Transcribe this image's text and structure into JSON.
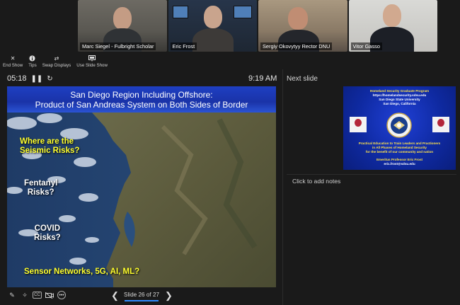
{
  "participants": [
    {
      "name": "Marc Siegel - Fulbright Scholar",
      "active": false
    },
    {
      "name": "Eric Frost",
      "active": true
    },
    {
      "name": "Sergiy Okovytyy Rector DNU",
      "active": false
    },
    {
      "name": "Vitor Gasso",
      "active": false
    }
  ],
  "toolbar": {
    "end_show": "End Show",
    "tips": "Tips",
    "swap_displays": "Swap Displays",
    "use_slide_show": "Use Slide Show"
  },
  "presenter": {
    "timer": "05:18",
    "clock": "9:19 AM",
    "slide_count": "Slide 26 of 27"
  },
  "slide": {
    "title_line1": "San Diego Region Including Offshore:",
    "title_line2": "Product of San Andreas System on Both Sides of Border",
    "callouts": {
      "seismic_1": "Where are the",
      "seismic_2": "Seismic Risks?",
      "fentanyl_1": "Fentanyl",
      "fentanyl_2": "Risks?",
      "covid_1": "COVID",
      "covid_2": "Risks?",
      "sensor": "Sensor Networks, 5G, AI, ML?"
    }
  },
  "next_panel": {
    "label": "Next slide",
    "notes_placeholder": "Click to add notes"
  },
  "next_slide": {
    "line1": "Homeland Security Graduate Program",
    "line2": "https://homelandsecurity.sdsu.edu",
    "line3": "San Diego State University",
    "line4": "San Diego, California",
    "line5": "Practical Education to Train Leaders and Practioners",
    "line6": "in All Phases of Homeland Security",
    "line7": "for the benefit of our community and nation",
    "line8": "Emeritus Professor Eric Frost",
    "line9": "eric.frost@sdsu.edu"
  },
  "colors": {
    "active_speaker": "#25c74a",
    "slide_yellow": "#ffff2d",
    "accent_blue": "#2f8cff"
  }
}
